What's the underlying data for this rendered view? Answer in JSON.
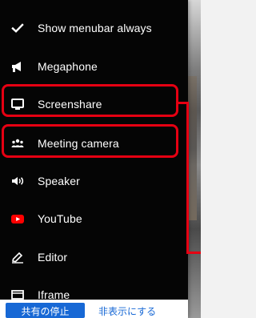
{
  "menu": {
    "items": [
      {
        "label": "Show menubar always",
        "icon": "check-icon"
      },
      {
        "label": "Megaphone",
        "icon": "megaphone-icon"
      },
      {
        "label": "Screenshare",
        "icon": "monitor-icon"
      },
      {
        "label": "Meeting camera",
        "icon": "people-icon"
      },
      {
        "label": "Speaker",
        "icon": "speaker-icon"
      },
      {
        "label": "YouTube",
        "icon": "youtube-icon"
      },
      {
        "label": "Editor",
        "icon": "edit-icon"
      },
      {
        "label": "Iframe",
        "icon": "iframe-icon"
      }
    ]
  },
  "footer": {
    "primary_button": "共有の停止",
    "secondary_button": "非表示にする"
  },
  "colors": {
    "menu_background": "#050505",
    "text": "#ffffff",
    "highlight": "#e60012",
    "youtube": "#ff0000",
    "primary_button": "#1768d5"
  }
}
